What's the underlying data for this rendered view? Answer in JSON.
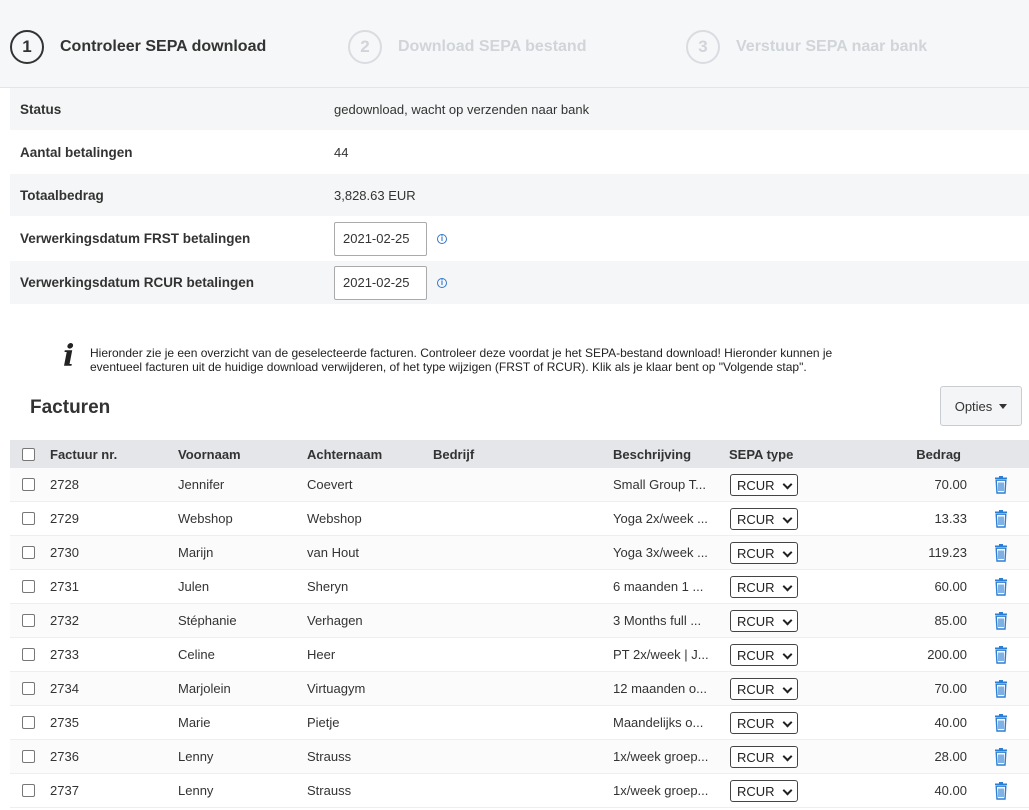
{
  "steps": [
    {
      "number": "1",
      "label": "Controleer SEPA download",
      "active": true
    },
    {
      "number": "2",
      "label": "Download SEPA bestand",
      "active": false
    },
    {
      "number": "3",
      "label": "Verstuur SEPA naar bank",
      "active": false
    }
  ],
  "info": {
    "status_label": "Status",
    "status_value": "gedownload, wacht op verzenden naar bank",
    "count_label": "Aantal betalingen",
    "count_value": "44",
    "total_label": "Totaalbedrag",
    "total_value": "3,828.63 EUR",
    "frst_label": "Verwerkingsdatum FRST betalingen",
    "frst_value": "2021-02-25",
    "rcur_label": "Verwerkingsdatum RCUR betalingen",
    "rcur_value": "2021-02-25"
  },
  "notice": {
    "line1": "Hieronder zie je een overzicht van de geselecteerde facturen. Controleer deze voordat je het SEPA-bestand download! Hieronder kunnen je",
    "line2": "eventueel facturen uit de huidige download verwijderen, of het type wijzigen (FRST of RCUR). Klik als je klaar bent op \"Volgende stap\"."
  },
  "section": {
    "title": "Facturen",
    "options_label": "Opties"
  },
  "table": {
    "headers": {
      "nr": "Factuur nr.",
      "first": "Voornaam",
      "last": "Achternaam",
      "company": "Bedrijf",
      "desc": "Beschrijving",
      "sepa": "SEPA type",
      "amount": "Bedrag"
    },
    "rows": [
      {
        "nr": "2728",
        "first": "Jennifer",
        "last": "Coevert",
        "company": "",
        "desc": "Small Group T...",
        "sepa": "RCUR",
        "amount": "70.00"
      },
      {
        "nr": "2729",
        "first": "Webshop",
        "last": "Webshop",
        "company": "",
        "desc": "Yoga 2x/week ...",
        "sepa": "RCUR",
        "amount": "13.33"
      },
      {
        "nr": "2730",
        "first": "Marijn",
        "last": "van Hout",
        "company": "",
        "desc": "Yoga 3x/week ...",
        "sepa": "RCUR",
        "amount": "119.23"
      },
      {
        "nr": "2731",
        "first": "Julen",
        "last": "Sheryn",
        "company": "",
        "desc": "6 maanden 1 ...",
        "sepa": "RCUR",
        "amount": "60.00"
      },
      {
        "nr": "2732",
        "first": "Stéphanie",
        "last": "Verhagen",
        "company": "",
        "desc": "3 Months full ...",
        "sepa": "RCUR",
        "amount": "85.00"
      },
      {
        "nr": "2733",
        "first": "Celine",
        "last": "Heer",
        "company": "",
        "desc": "PT 2x/week | J...",
        "sepa": "RCUR",
        "amount": "200.00"
      },
      {
        "nr": "2734",
        "first": "Marjolein",
        "last": "Virtuagym",
        "company": "",
        "desc": "12 maanden o...",
        "sepa": "RCUR",
        "amount": "70.00"
      },
      {
        "nr": "2735",
        "first": "Marie",
        "last": "Pietje",
        "company": "",
        "desc": "Maandelijks o...",
        "sepa": "RCUR",
        "amount": "40.00"
      },
      {
        "nr": "2736",
        "first": "Lenny",
        "last": "Strauss",
        "company": "",
        "desc": "1x/week groep...",
        "sepa": "RCUR",
        "amount": "28.00"
      },
      {
        "nr": "2737",
        "first": "Lenny",
        "last": "Strauss",
        "company": "",
        "desc": "1x/week groep...",
        "sepa": "RCUR",
        "amount": "40.00"
      }
    ]
  },
  "colors": {
    "accent": "#3377cc",
    "trash": "#2a7fd4",
    "header_bg": "#e4e6e9"
  },
  "icons": {
    "info": "info-circle-icon",
    "notice": "italic-i-icon",
    "delete": "trash-icon",
    "dropdown": "caret-down-icon"
  }
}
